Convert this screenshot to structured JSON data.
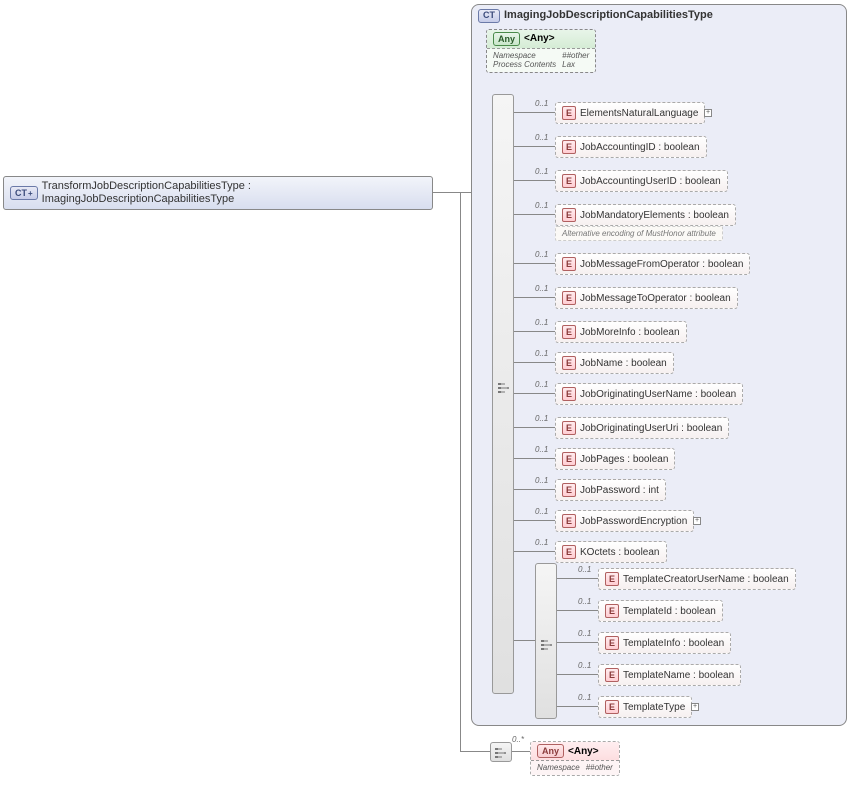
{
  "left": {
    "badge": "CT",
    "name": "TransformJobDescriptionCapabilitiesType",
    "base": "ImagingJobDescriptionCapabilitiesType"
  },
  "main": {
    "badge": "CT",
    "title": "ImagingJobDescriptionCapabilitiesType"
  },
  "any_top": {
    "badge": "Any",
    "label": "<Any>",
    "ns_label": "Namespace",
    "ns_val": "##other",
    "pc_label": "Process Contents",
    "pc_val": "Lax"
  },
  "card": "0..1",
  "elements": [
    {
      "label": "ElementsNaturalLanguage",
      "expand": true
    },
    {
      "label": "JobAccountingID : boolean"
    },
    {
      "label": "JobAccountingUserID : boolean"
    },
    {
      "label": "JobMandatoryElements : boolean",
      "annot": "Alternative encoding of MustHonor attribute"
    },
    {
      "label": "JobMessageFromOperator : boolean"
    },
    {
      "label": "JobMessageToOperator : boolean"
    },
    {
      "label": "JobMoreInfo : boolean"
    },
    {
      "label": "JobName : boolean"
    },
    {
      "label": "JobOriginatingUserName : boolean"
    },
    {
      "label": "JobOriginatingUserUri : boolean"
    },
    {
      "label": "JobPages : boolean"
    },
    {
      "label": "JobPassword : int"
    },
    {
      "label": "JobPasswordEncryption",
      "expand": true
    },
    {
      "label": "KOctets  : boolean"
    }
  ],
  "inner_elements": [
    {
      "label": "TemplateCreatorUserName : boolean"
    },
    {
      "label": "TemplateId : boolean"
    },
    {
      "label": "TemplateInfo : boolean"
    },
    {
      "label": "TemplateName : boolean"
    },
    {
      "label": "TemplateType",
      "expand": true
    }
  ],
  "bottom_any": {
    "badge": "Any",
    "label": "<Any>",
    "ns_label": "Namespace",
    "ns_val": "##other",
    "card": "0..*"
  }
}
